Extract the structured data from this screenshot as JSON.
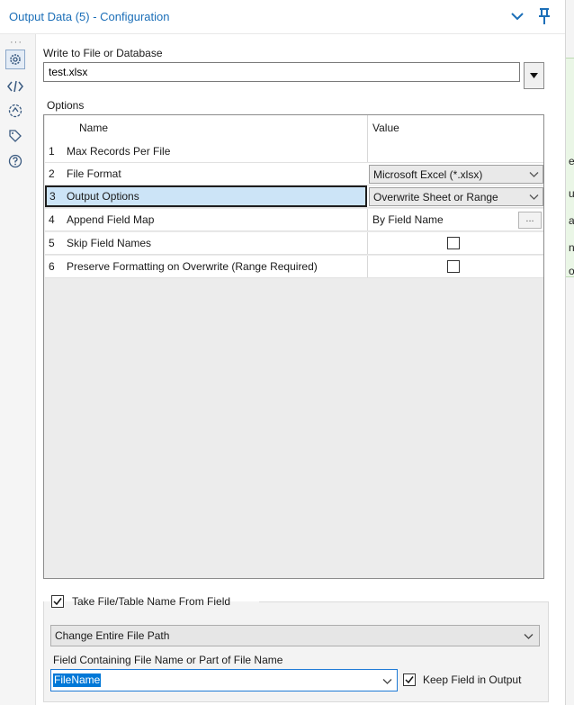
{
  "window": {
    "title": "Output Data (5) - Configuration",
    "edge_glyphs": [
      "e",
      "u",
      "a",
      "n",
      "o"
    ]
  },
  "toolbar": {
    "more": "···",
    "items": [
      {
        "icon": "gear-icon",
        "active": true
      },
      {
        "icon": "xml-icon"
      },
      {
        "icon": "metainfo-icon"
      },
      {
        "icon": "annotation-tag-icon"
      },
      {
        "icon": "help-icon"
      }
    ]
  },
  "write": {
    "label": "Write to File or Database",
    "value": "test.xlsx"
  },
  "options": {
    "label": "Options",
    "columns": {
      "name": "Name",
      "value": "Value"
    },
    "rows": [
      {
        "num": "1",
        "name": "Max Records Per File",
        "value": ""
      },
      {
        "num": "2",
        "name": "File Format",
        "value": "Microsoft Excel (*.xlsx)"
      },
      {
        "num": "3",
        "name": "Output Options",
        "value": "Overwrite Sheet or Range"
      },
      {
        "num": "4",
        "name": "Append Field Map",
        "value": "By Field Name",
        "button": "..."
      },
      {
        "num": "5",
        "name": "Skip Field Names",
        "checked": false
      },
      {
        "num": "6",
        "name": "Preserve Formatting on Overwrite (Range Required)",
        "checked": false
      }
    ],
    "selected_row": 3
  },
  "filename_from_field": {
    "enabled": true,
    "label": "Take File/Table Name From Field",
    "mode": "Change Entire File Path",
    "field_label": "Field Containing File Name or Part of File Name",
    "field_value": "FileName",
    "keep_field": true,
    "keep_label": "Keep Field in Output"
  },
  "colors": {
    "title": "#1c6fb8",
    "selection": "#cce4f7",
    "accent": "#0078d7"
  }
}
